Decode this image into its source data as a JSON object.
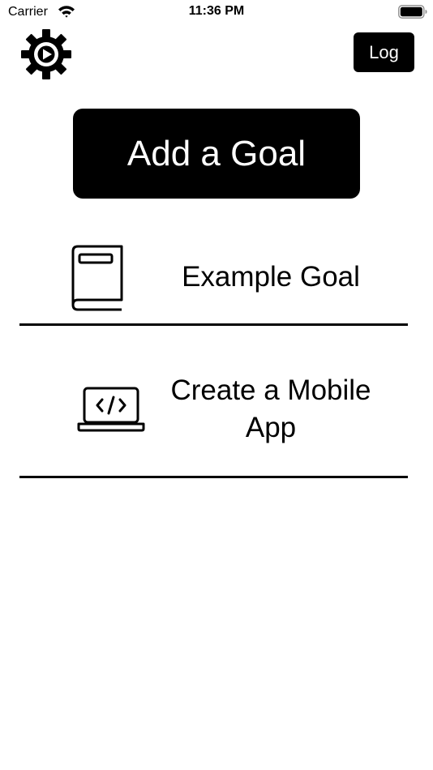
{
  "status_bar": {
    "carrier": "Carrier",
    "time": "11:36 PM",
    "wifi_icon": "wifi-icon",
    "battery_icon": "battery-icon"
  },
  "header": {
    "settings_icon": "gear-icon",
    "log_label": "Log"
  },
  "add_goal": {
    "label": "Add a Goal"
  },
  "goals": [
    {
      "icon": "book-icon",
      "title": "Example Goal"
    },
    {
      "icon": "laptop-code-icon",
      "title": "Create a Mobile App"
    }
  ],
  "colors": {
    "background": "#ffffff",
    "primary": "#000000",
    "on_primary": "#ffffff"
  }
}
